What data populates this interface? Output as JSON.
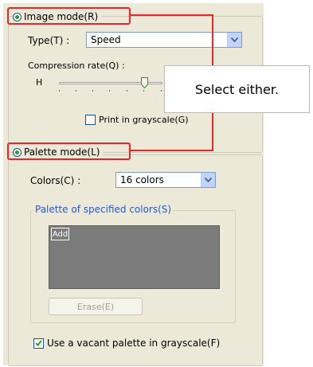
{
  "image_mode": {
    "label": "Image mode(R)",
    "selected": true,
    "type_label": "Type(T) :",
    "type_value": "Speed",
    "compression_label": "Compression rate(Q) :",
    "slider_min_label": "H",
    "grayscale_checkbox_label": "Print in grayscale(G)",
    "grayscale_checked": false
  },
  "palette_mode": {
    "label": "Palette mode(L)",
    "selected": true,
    "colors_label": "Colors(C) :",
    "colors_value": "16 colors",
    "specified_group_label": "Palette of specified colors(S)",
    "add_label": "Add",
    "erase_label": "Erase(E)",
    "vacant_palette_label": "Use a vacant palette in grayscale(F)",
    "vacant_palette_checked": true
  },
  "callout": {
    "text": "Select either."
  },
  "colors": {
    "highlight": "#e8262b",
    "panel": "#ece9d8",
    "radio_dot": "#21a121",
    "group_label": "#2b58c2"
  }
}
